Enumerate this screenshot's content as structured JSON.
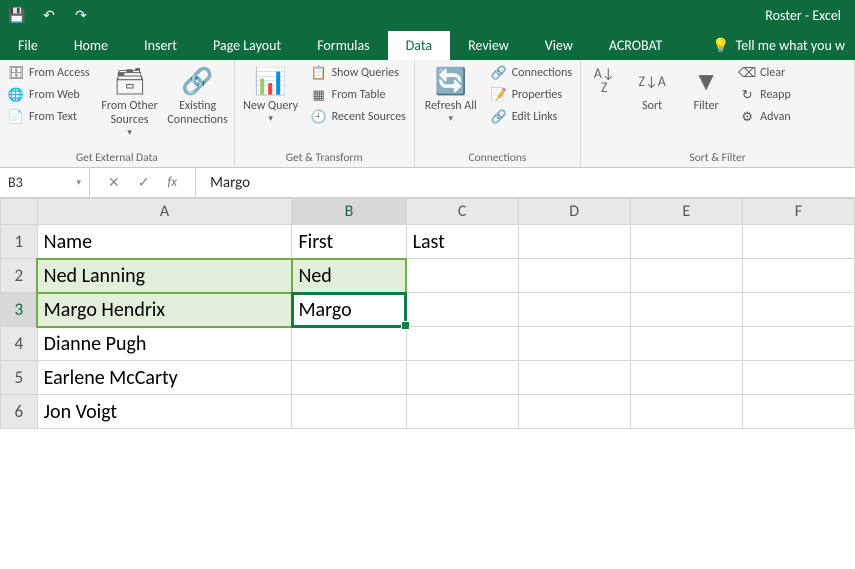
{
  "titlebar": {
    "title": "Roster - Excel"
  },
  "tabs": {
    "file": "File",
    "home": "Home",
    "insert": "Insert",
    "page_layout": "Page Layout",
    "formulas": "Formulas",
    "data": "Data",
    "review": "Review",
    "view": "View",
    "acrobat": "ACROBAT",
    "tellme": "Tell me what you w"
  },
  "ribbon": {
    "ext": {
      "access": "From Access",
      "web": "From Web",
      "text": "From Text",
      "other": "From Other Sources",
      "existing": "Existing Connections",
      "label": "Get External Data"
    },
    "gt": {
      "newq": "New Query",
      "show": "Show Queries",
      "table": "From Table",
      "recent": "Recent Sources",
      "label": "Get & Transform"
    },
    "conn": {
      "refresh": "Refresh All",
      "connections": "Connections",
      "properties": "Properties",
      "edit": "Edit Links",
      "label": "Connections"
    },
    "sf": {
      "sort": "Sort",
      "filter": "Filter",
      "clear": "Clear",
      "reapply": "Reapp",
      "advanced": "Advan",
      "label": "Sort & Filter"
    }
  },
  "formula_bar": {
    "name_box": "B3",
    "value": "Margo"
  },
  "columns": [
    "A",
    "B",
    "C",
    "D",
    "E",
    "F"
  ],
  "selected_col_index": 1,
  "row_headers": [
    "1",
    "2",
    "3",
    "4",
    "5",
    "6"
  ],
  "selected_row_index": 2,
  "cells": {
    "A1": "Name",
    "B1": "First",
    "C1": "Last",
    "A2": "Ned Lanning",
    "B2": "Ned",
    "A3": "Margo Hendrix",
    "B3": "Margo",
    "A4": "Dianne Pugh",
    "A5": "Earlene McCarty",
    "A6": "Jon Voigt"
  },
  "active_cell": "B3"
}
